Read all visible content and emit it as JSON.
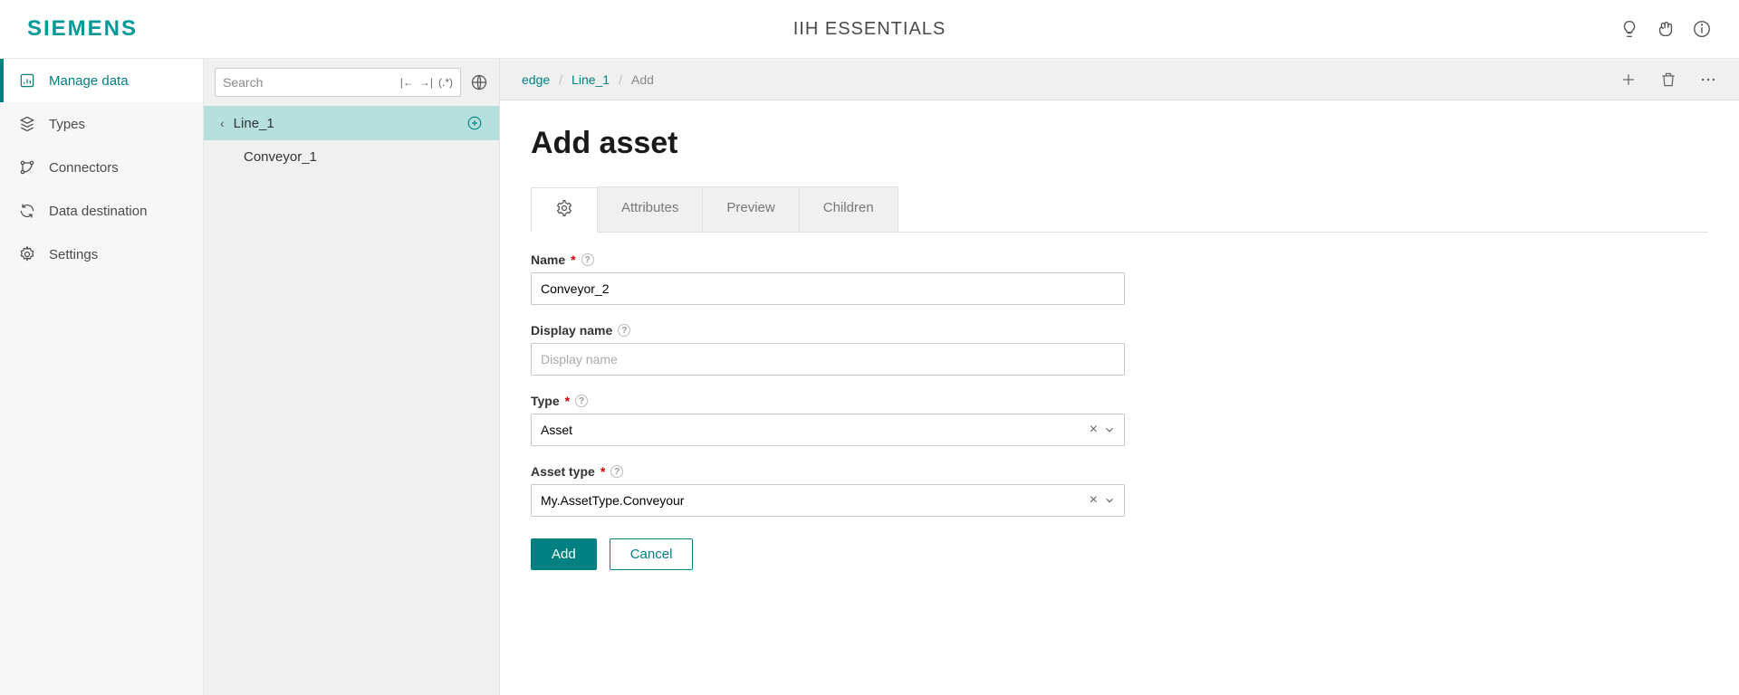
{
  "header": {
    "brand": "SIEMENS",
    "app_title": "IIH ESSENTIALS"
  },
  "sidebar": {
    "items": [
      {
        "label": "Manage data"
      },
      {
        "label": "Types"
      },
      {
        "label": "Connectors"
      },
      {
        "label": "Data destination"
      },
      {
        "label": "Settings"
      }
    ]
  },
  "tree": {
    "search_placeholder": "Search",
    "items": [
      {
        "label": "Line_1"
      },
      {
        "label": "Conveyor_1"
      }
    ]
  },
  "breadcrumb": {
    "root": "edge",
    "parent": "Line_1",
    "current": "Add"
  },
  "page": {
    "title": "Add asset"
  },
  "tabs": {
    "t1": "Attributes",
    "t2": "Preview",
    "t3": "Children"
  },
  "form": {
    "name_label": "Name",
    "name_value": "Conveyor_2",
    "display_name_label": "Display name",
    "display_name_placeholder": "Display name",
    "display_name_value": "",
    "type_label": "Type",
    "type_value": "Asset",
    "asset_type_label": "Asset type",
    "asset_type_value": "My.AssetType.Conveyour",
    "required_mark": "*"
  },
  "buttons": {
    "add": "Add",
    "cancel": "Cancel"
  }
}
